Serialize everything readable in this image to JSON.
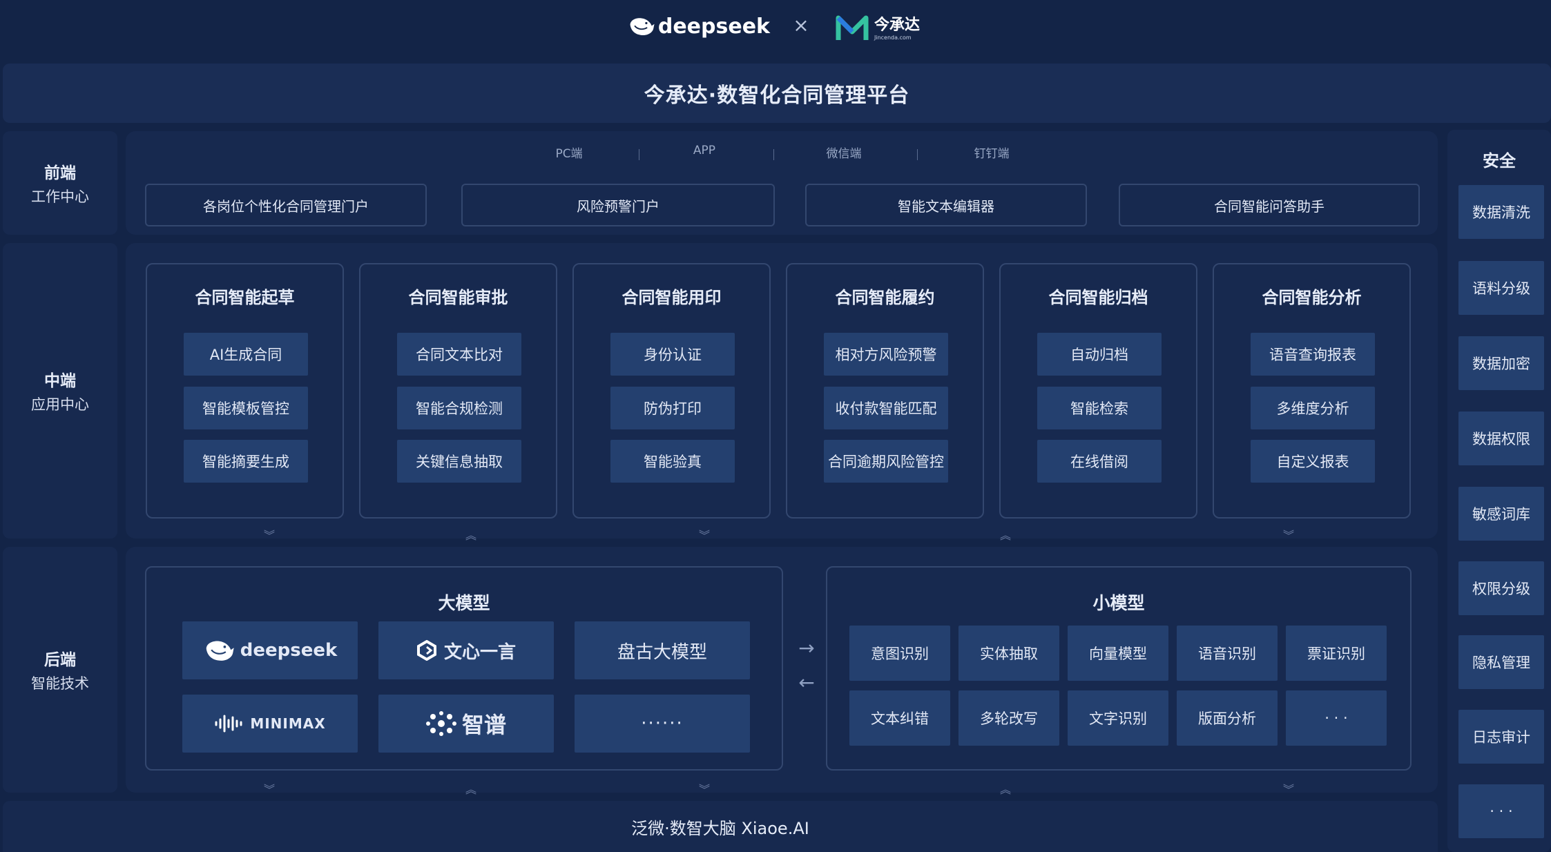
{
  "header": {
    "partner_logo": "deepseek",
    "separator": "×",
    "brand_logo": "今承达",
    "brand_logo_sub": "Jincenda.com"
  },
  "title": "今承达·数智化合同管理平台",
  "rows": {
    "front": {
      "label": "前端",
      "sublabel": "工作中心"
    },
    "mid": {
      "label": "中端",
      "sublabel": "应用中心"
    },
    "back": {
      "label": "后端",
      "sublabel": "智能技术"
    }
  },
  "channels": [
    "PC端",
    "APP",
    "微信端",
    "钉钉端"
  ],
  "portals": [
    "各岗位个性化合同管理门户",
    "风险预警门户",
    "智能文本编辑器",
    "合同智能问答助手"
  ],
  "modules": [
    {
      "title": "合同智能起草",
      "items": [
        "AI生成合同",
        "智能模板管控",
        "智能摘要生成"
      ]
    },
    {
      "title": "合同智能审批",
      "items": [
        "合同文本比对",
        "智能合规检测",
        "关键信息抽取"
      ]
    },
    {
      "title": "合同智能用印",
      "items": [
        "身份认证",
        "防伪打印",
        "智能验真"
      ]
    },
    {
      "title": "合同智能履约",
      "items": [
        "相对方风险预警",
        "收付款智能匹配",
        "合同逾期风险管控"
      ]
    },
    {
      "title": "合同智能归档",
      "items": [
        "自动归档",
        "智能检索",
        "在线借阅"
      ]
    },
    {
      "title": "合同智能分析",
      "items": [
        "语音查询报表",
        "多维度分析",
        "自定义报表"
      ]
    }
  ],
  "large_models": {
    "title": "大模型",
    "items": [
      "deepseek",
      "文心一言",
      "盘古大模型",
      "MINIMAX",
      "智谱",
      "······"
    ]
  },
  "small_models": {
    "title": "小模型",
    "items": [
      "意图识别",
      "实体抽取",
      "向量模型",
      "语音识别",
      "票证识别",
      "文本纠错",
      "多轮改写",
      "文字识别",
      "版面分析",
      "· · ·"
    ]
  },
  "exchange_arrows": [
    "→",
    "←"
  ],
  "security": {
    "title": "安全",
    "items": [
      "数据清洗",
      "语料分级",
      "数据加密",
      "数据权限",
      "敏感词库",
      "权限分级",
      "隐私管理",
      "日志审计",
      "· · ·"
    ]
  },
  "footer": "泛微·数智大脑 Xiaoe.AI",
  "colors": {
    "background": "#132447",
    "panel": "#17294f",
    "chip": "#24406f",
    "border": "#33476f",
    "accent_green": "#35c2a0",
    "accent_blue": "#2b7de0"
  }
}
